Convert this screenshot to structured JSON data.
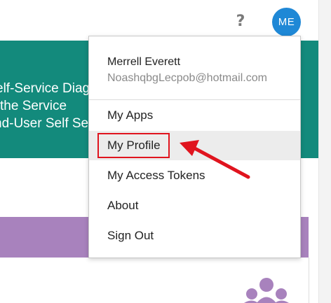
{
  "header": {
    "help_glyph": "?",
    "avatar_initials": "ME"
  },
  "banner": {
    "line1": "elf-Service Diag",
    "line2": "the Service",
    "line3": "nd-User Self Se",
    "color": "#138a7c"
  },
  "profile_menu": {
    "user_name": "Merrell Everett",
    "user_email": "NoashqbgLecpob@hotmail.com",
    "items": [
      {
        "label": "My Apps"
      },
      {
        "label": "My Profile"
      },
      {
        "label": "My Access Tokens"
      },
      {
        "label": "About"
      },
      {
        "label": "Sign Out"
      }
    ],
    "highlighted_item": "My Profile"
  },
  "colors": {
    "avatar": "#1f88d6",
    "purple_band": "#a882bd",
    "annotation": "#e0141e"
  },
  "icons": [
    "help-icon",
    "people-icon",
    "annotation-arrow"
  ]
}
